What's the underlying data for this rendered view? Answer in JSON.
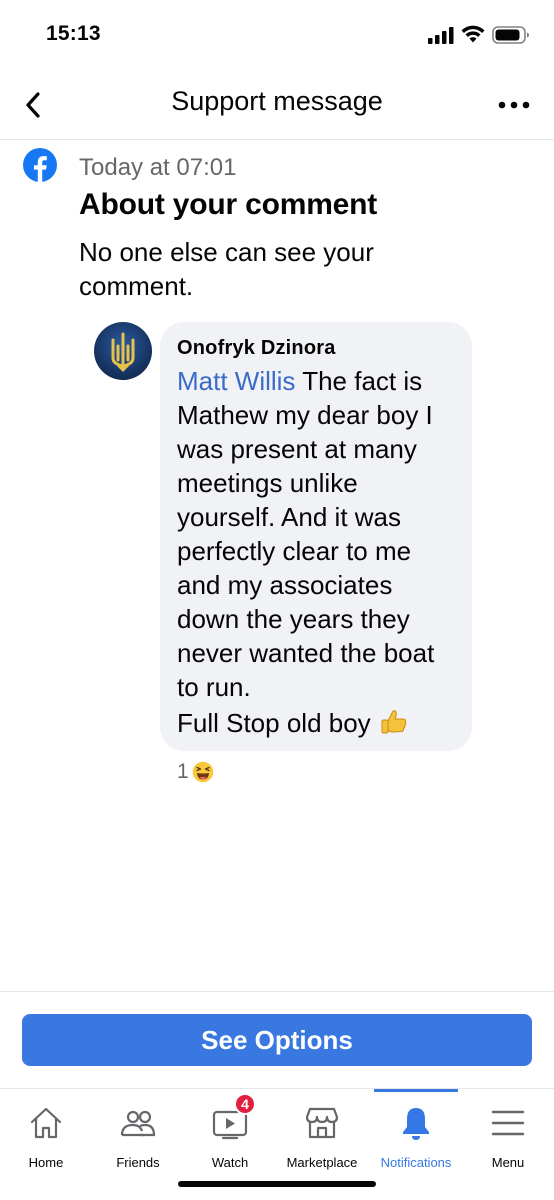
{
  "status_bar": {
    "time": "15:13"
  },
  "header": {
    "title": "Support message"
  },
  "message": {
    "timestamp": "Today at 07:01",
    "title": "About your comment",
    "body": "No one else can see your comment."
  },
  "comment": {
    "author": "Onofryk Dzinora",
    "mention": "Matt Willis",
    "text": " The fact is Mathew my dear boy I was present at many meetings unlike yourself. And it was perfectly clear to me and my associates down the years they never wanted the boat to run.",
    "closing": "Full Stop old boy",
    "reaction_count": "1"
  },
  "actions": {
    "see_options_label": "See Options"
  },
  "tabs": [
    {
      "label": "Home",
      "icon": "home-icon"
    },
    {
      "label": "Friends",
      "icon": "friends-icon"
    },
    {
      "label": "Watch",
      "icon": "watch-icon",
      "badge": "4"
    },
    {
      "label": "Marketplace",
      "icon": "marketplace-icon"
    },
    {
      "label": "Notifications",
      "icon": "bell-icon",
      "active": true
    },
    {
      "label": "Menu",
      "icon": "menu-icon"
    }
  ],
  "colors": {
    "accent": "#3578e5",
    "button": "#3878e0",
    "badge": "#e41e3f",
    "bubble": "#f0f2f5",
    "mention": "#3a6bc9"
  }
}
